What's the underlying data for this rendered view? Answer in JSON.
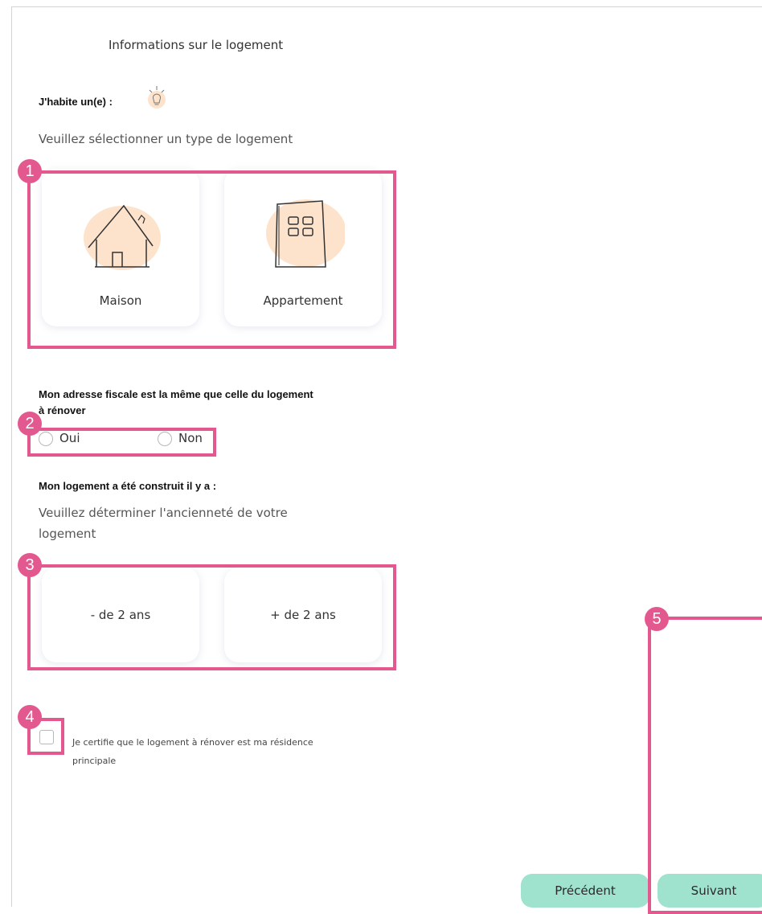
{
  "form": {
    "title": "Informations sur le logement",
    "housing_question": "J'habite un(e) :",
    "housing_hint": "Veuillez sélectionner un type de logement",
    "housing_options": [
      "Maison",
      "Appartement"
    ],
    "fiscal_question_line1": "Mon adresse fiscale est la même que celle du logement",
    "fiscal_question_line2": "à rénover",
    "fiscal_options": [
      "Oui",
      "Non"
    ],
    "age_question": "Mon logement a été construit il y a :",
    "age_hint_line1": "Veuillez déterminer l'ancienneté de votre",
    "age_hint_line2": "logement",
    "age_options": [
      "- de 2 ans",
      "+ de 2 ans"
    ],
    "certify_line1": "Je certifie que le logement à rénover est ma résidence",
    "certify_line2": "principale"
  },
  "nav": {
    "previous_label": "Précédent",
    "next_label": "Suivant"
  },
  "annotations": [
    "1",
    "2",
    "3",
    "4",
    "5"
  ],
  "colors": {
    "highlight": "#e3588e",
    "button": "#9fe3cf",
    "icon_blob": "#fde3cc"
  },
  "icons": {
    "hint": "lightbulb-icon",
    "house": "house-icon",
    "apartment": "apartment-building-icon"
  }
}
